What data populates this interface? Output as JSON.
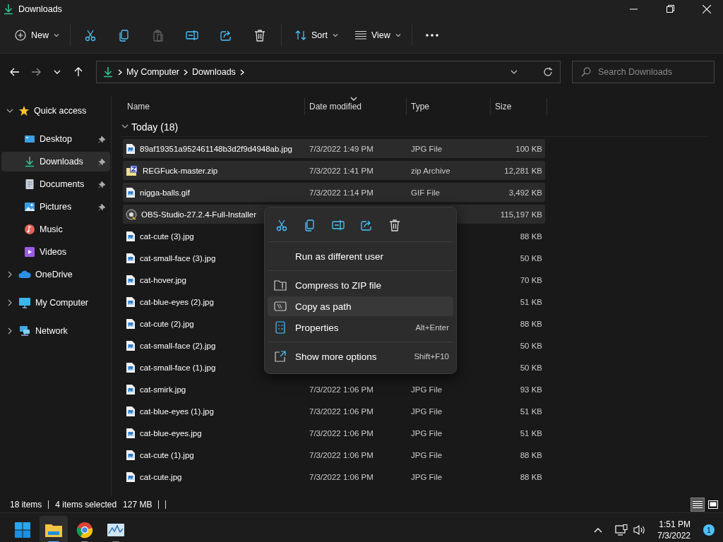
{
  "window": {
    "title": "Downloads"
  },
  "toolbar": {
    "actions": [
      {
        "kind": "new",
        "label": "New",
        "disabled": false
      },
      {
        "kind": "cut",
        "disabled": false
      },
      {
        "kind": "copy",
        "disabled": false
      },
      {
        "kind": "paste",
        "disabled": true
      },
      {
        "kind": "rename",
        "disabled": false
      },
      {
        "kind": "share",
        "disabled": false
      },
      {
        "kind": "delete",
        "disabled": false
      },
      {
        "kind": "sort",
        "label": "Sort",
        "disabled": false
      },
      {
        "kind": "view",
        "label": "View",
        "disabled": false
      },
      {
        "kind": "more",
        "disabled": false
      }
    ]
  },
  "address_bar": {
    "breadcrumbs": [
      "My Computer",
      "Downloads"
    ]
  },
  "search": {
    "placeholder": "Search Downloads"
  },
  "sidebar": {
    "items": [
      {
        "label": "Quick access",
        "kind": "star",
        "expanded": true,
        "selected": false,
        "children": [
          {
            "label": "Desktop",
            "kind": "desktop",
            "pinned": true,
            "selected": false
          },
          {
            "label": "Downloads",
            "kind": "download",
            "pinned": true,
            "selected": true
          },
          {
            "label": "Documents",
            "kind": "document",
            "pinned": true,
            "selected": false
          },
          {
            "label": "Pictures",
            "kind": "pictures",
            "pinned": true,
            "selected": false
          },
          {
            "label": "Music",
            "kind": "music",
            "pinned": false,
            "selected": false
          },
          {
            "label": "Videos",
            "kind": "videos",
            "pinned": false,
            "selected": false
          }
        ]
      },
      {
        "label": "OneDrive",
        "kind": "cloud",
        "expanded": false,
        "selected": false
      },
      {
        "label": "My Computer",
        "kind": "computer",
        "expanded": false,
        "selected": false
      },
      {
        "label": "Network",
        "kind": "network",
        "expanded": false,
        "selected": false
      }
    ]
  },
  "table": {
    "columns": [
      {
        "label": "Name",
        "sorted": false
      },
      {
        "label": "Date modified",
        "sorted": true
      },
      {
        "label": "Type",
        "sorted": false
      },
      {
        "label": "Size",
        "sorted": false
      }
    ],
    "group": {
      "label": "Today (18)",
      "expanded": true
    },
    "rows": [
      {
        "name": "89af19351a952461148b3d2f9d4948ab.jpg",
        "date": "7/3/2022 1:49 PM",
        "type": "JPG File",
        "size": "100 KB",
        "kind": "image",
        "selected": true
      },
      {
        "name": "REGFuck-master.zip",
        "date": "7/3/2022 1:41 PM",
        "type": "zip Archive",
        "size": "12,281 KB",
        "kind": "zip",
        "selected": true
      },
      {
        "name": "nigga-balls.gif",
        "date": "7/3/2022 1:14 PM",
        "type": "GIF File",
        "size": "3,492 KB",
        "kind": "image",
        "selected": true
      },
      {
        "name": "OBS-Studio-27.2.4-Full-Installer",
        "size": "115,197 KB",
        "kind": "installer",
        "selected": true
      },
      {
        "name": "cat-cute (3).jpg",
        "size": "88 KB",
        "kind": "image",
        "selected": false
      },
      {
        "name": "cat-small-face (3).jpg",
        "size": "50 KB",
        "kind": "image",
        "selected": false
      },
      {
        "name": "cat-hover.jpg",
        "size": "70 KB",
        "kind": "image",
        "selected": false
      },
      {
        "name": "cat-blue-eyes (2).jpg",
        "size": "51 KB",
        "kind": "image",
        "selected": false
      },
      {
        "name": "cat-cute (2).jpg",
        "size": "88 KB",
        "kind": "image",
        "selected": false
      },
      {
        "name": "cat-small-face (2).jpg",
        "size": "50 KB",
        "kind": "image",
        "selected": false
      },
      {
        "name": "cat-small-face (1).jpg",
        "size": "50 KB",
        "kind": "image",
        "selected": false
      },
      {
        "name": "cat-smirk.jpg",
        "date": "7/3/2022 1:06 PM",
        "type": "JPG File",
        "size": "93 KB",
        "kind": "image",
        "selected": false
      },
      {
        "name": "cat-blue-eyes (1).jpg",
        "date": "7/3/2022 1:06 PM",
        "type": "JPG File",
        "size": "51 KB",
        "kind": "image",
        "selected": false
      },
      {
        "name": "cat-blue-eyes.jpg",
        "date": "7/3/2022 1:06 PM",
        "type": "JPG File",
        "size": "51 KB",
        "kind": "image",
        "selected": false
      },
      {
        "name": "cat-cute (1).jpg",
        "date": "7/3/2022 1:06 PM",
        "type": "JPG File",
        "size": "88 KB",
        "kind": "image",
        "selected": false
      },
      {
        "name": "cat-cute.jpg",
        "date": "7/3/2022 1:06 PM",
        "type": "JPG File",
        "size": "88 KB",
        "kind": "image",
        "selected": false
      }
    ]
  },
  "context_menu": {
    "quick_actions": [
      {
        "kind": "cut"
      },
      {
        "kind": "copy"
      },
      {
        "kind": "rename"
      },
      {
        "kind": "share"
      },
      {
        "kind": "delete"
      }
    ],
    "groups": [
      [
        {
          "label": "Run as different user",
          "kind": "none",
          "selected": false
        }
      ],
      [
        {
          "label": "Compress to ZIP file",
          "kind": "zip",
          "selected": false
        },
        {
          "label": "Copy as path",
          "kind": "path",
          "selected": true
        },
        {
          "label": "Properties",
          "kind": "properties",
          "shortcut": "Alt+Enter",
          "selected": false
        }
      ],
      [
        {
          "label": "Show more options",
          "kind": "more",
          "shortcut": "Shift+F10",
          "selected": false
        }
      ]
    ]
  },
  "status_bar": {
    "items": [
      "18 items",
      "4 items selected",
      "127 MB"
    ],
    "views": [
      {
        "kind": "details",
        "selected": true
      },
      {
        "kind": "tiles",
        "selected": false
      }
    ]
  },
  "taskbar": {
    "apps": [
      {
        "kind": "start",
        "active": false,
        "running": false
      },
      {
        "kind": "explorer",
        "active": true,
        "running": true
      },
      {
        "kind": "chrome",
        "active": false,
        "running": true
      },
      {
        "kind": "monitor",
        "active": false,
        "running": true
      }
    ],
    "time": "1:51 PM",
    "date": "7/3/2022",
    "notifications": "1"
  }
}
